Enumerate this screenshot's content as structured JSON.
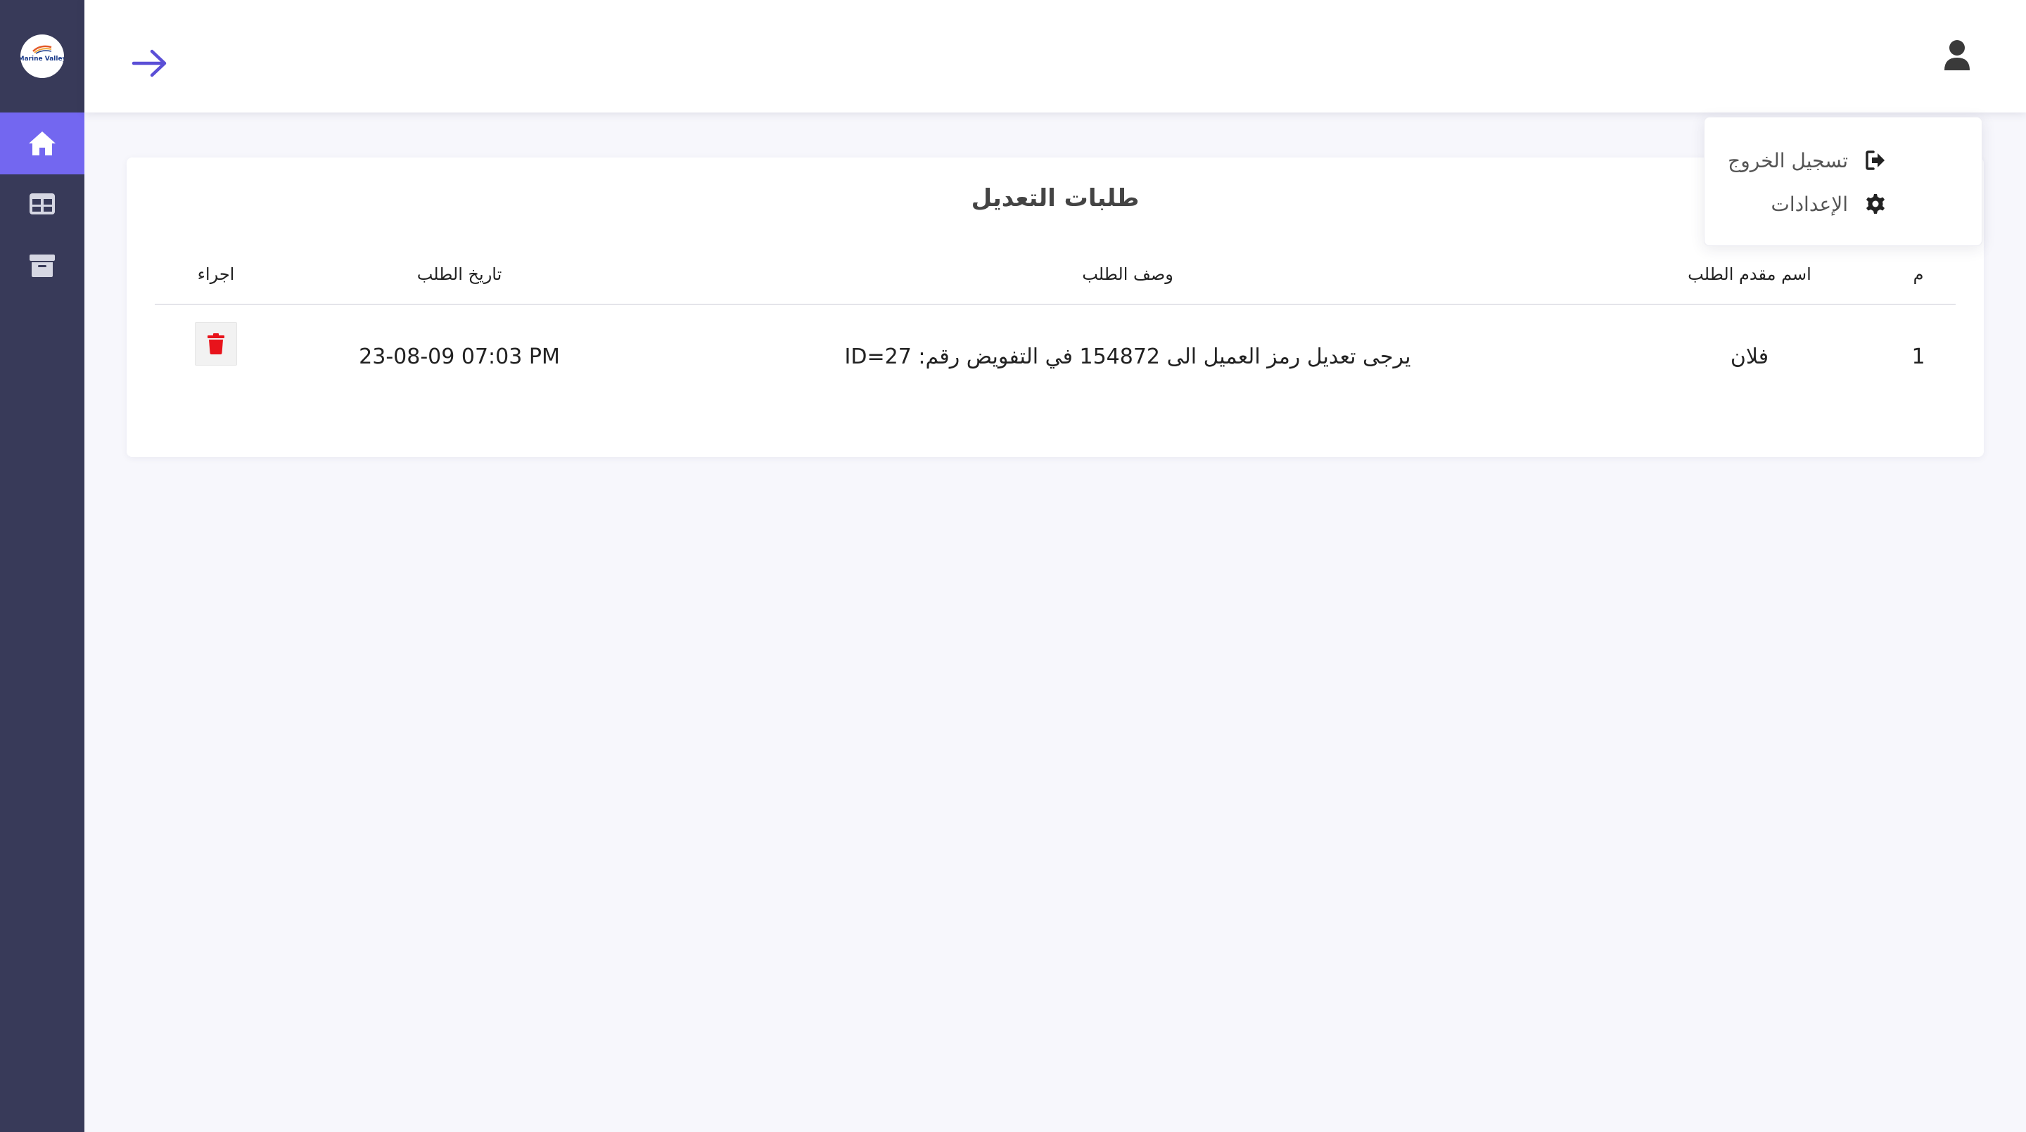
{
  "brand": {
    "logo_text": "Marine Valley"
  },
  "sidebar": {
    "items": [
      {
        "name": "home",
        "icon": "home-icon",
        "active": true
      },
      {
        "name": "tables",
        "icon": "table-icon",
        "active": false
      },
      {
        "name": "archive",
        "icon": "archive-icon",
        "active": false
      }
    ]
  },
  "header": {
    "back_icon": "arrow-right-icon",
    "user_icon": "user-icon"
  },
  "user_menu": {
    "logout_label": "تسجيل الخروج",
    "settings_label": "الإعدادات"
  },
  "page": {
    "title": "طلبات التعديل"
  },
  "table": {
    "columns": {
      "index": "م",
      "requester": "اسم مقدم الطلب",
      "description": "وصف الطلب",
      "date": "تاريخ الطلب",
      "action": "اجراء"
    },
    "rows": [
      {
        "index": "1",
        "requester": "فلان",
        "description": "يرجى تعديل رمز العميل الى 154872 في التفويض رقم: ID=27",
        "date": "23-08-09 07:03 PM"
      }
    ]
  },
  "colors": {
    "sidebar_bg": "#383a59",
    "accent": "#7367f0",
    "danger": "#e8131b",
    "page_bg": "#f7f7fc"
  }
}
